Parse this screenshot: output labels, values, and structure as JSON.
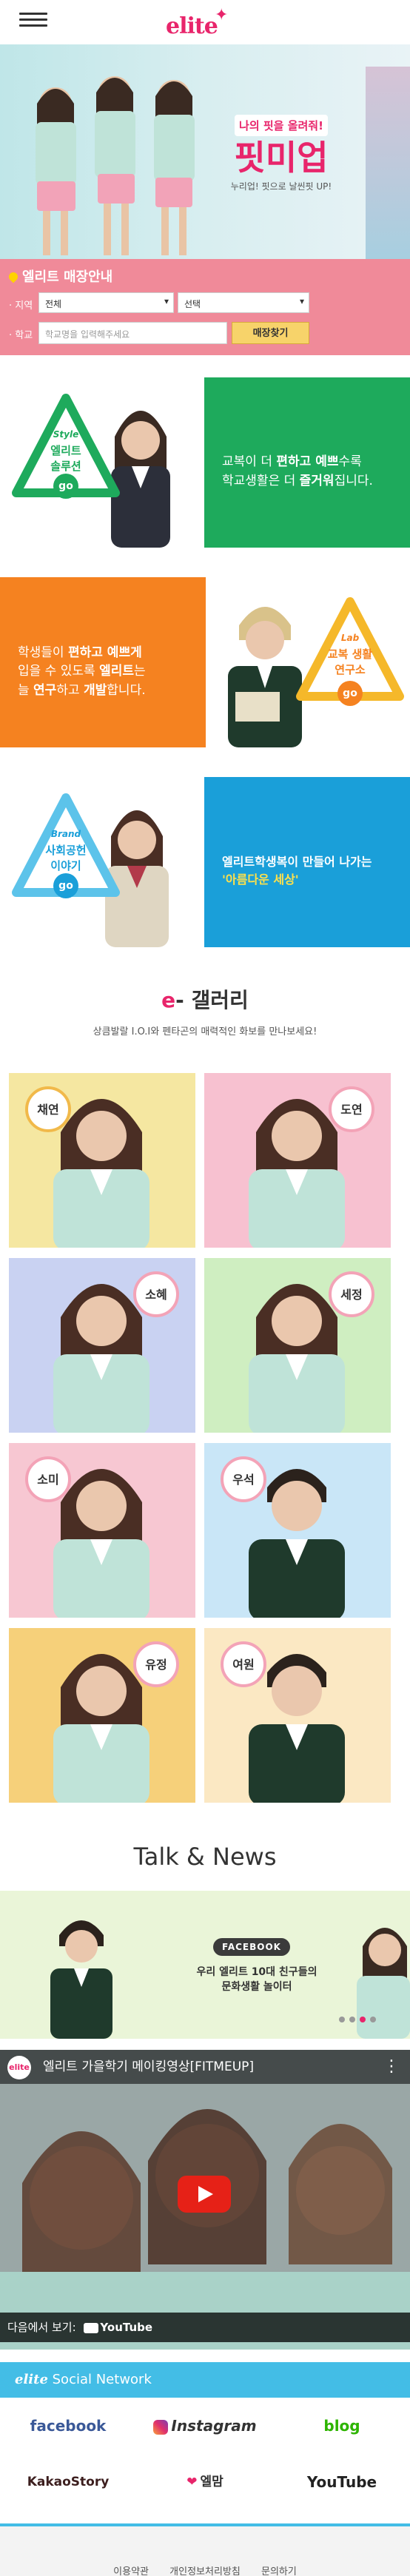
{
  "brand": {
    "logo": "elite",
    "accent": "#e8256b"
  },
  "hero": {
    "promo_small": "나의 핏을 올려줘!",
    "promo_big": "핏미업",
    "promo_sub": "누리업! 핏으로 날씬핏 UP!",
    "slide_count": 4,
    "active_slide": 2
  },
  "finder": {
    "title": "엘리트 매장안내",
    "region_label": "· 지역",
    "region_select": "전체",
    "city_select": "선택",
    "school_label": "· 학교",
    "school_placeholder": "학교명을 입력해주세요",
    "button": "매장찾기"
  },
  "features": [
    {
      "badge_top": "Style",
      "badge_main": "엘리트\n솔루션",
      "go": "go",
      "text_parts": [
        "교복이 더 ",
        "편하고 예쁘",
        "수록\n학교생활",
        "은 더 ",
        "즐거워",
        "집니다."
      ],
      "color": "#1eaa5c"
    },
    {
      "badge_top": "Lab",
      "badge_main": "교복 생활\n연구소",
      "go": "go",
      "text_parts": [
        "학생들이 ",
        "편하고 예쁘게",
        "\n입을 수 있도록 ",
        "엘리트",
        "는\n늘 ",
        "연구",
        "하고 ",
        "개발",
        "합니다."
      ],
      "color": "#f58220"
    },
    {
      "badge_top": "Brand",
      "badge_main": "사회공헌\n이야기",
      "go": "go",
      "text_parts": [
        "엘리트학생복이 만들어 나가는\n",
        "'아름다운 세상'"
      ],
      "color": "#1a9fd9"
    }
  ],
  "gallery": {
    "title_e": "e",
    "title_rest": "- 갤러리",
    "subtitle": "상큼발랄 I.O.I와 펜타곤의 매력적인 화보를 만나보세요!",
    "members": [
      {
        "name": "채연",
        "bg": "#f5e7a1"
      },
      {
        "name": "도연",
        "bg": "#f7c1d0"
      },
      {
        "name": "소혜",
        "bg": "#c9d2f2"
      },
      {
        "name": "세정",
        "bg": "#cfeec1"
      },
      {
        "name": "소미",
        "bg": "#f7c7d2"
      },
      {
        "name": "우석",
        "bg": "#c9e6f7"
      },
      {
        "name": "유정",
        "bg": "#f6d07a"
      },
      {
        "name": "여원",
        "bg": "#fbe8c3"
      }
    ]
  },
  "talk_news": {
    "title": "Talk & News",
    "tag": "FACEBOOK",
    "text": "우리 엘리트 10대 친구들의\n문화생활 놀이터"
  },
  "video": {
    "avatar": "elite",
    "title": "엘리트 가을학기 메이킹영상[FITMEUP]",
    "more": "⋮",
    "watch_on": "다음에서 보기:",
    "yt": "YouTube"
  },
  "social": {
    "head_brand": "elite",
    "head_rest": " Social Network",
    "items": [
      {
        "label": "facebook",
        "color": "#3b5998"
      },
      {
        "label": "Instagram",
        "color": "#333333"
      },
      {
        "label": "blog",
        "color": "#2db400"
      },
      {
        "label": "KakaoStory",
        "color": "#3c1e1e"
      },
      {
        "label": "엘맘",
        "color": "#333333"
      },
      {
        "label": "YouTube",
        "color": "#222222"
      }
    ]
  },
  "footer": {
    "links": [
      "이용약관",
      "개인정보처리방침",
      "문의하기"
    ]
  }
}
